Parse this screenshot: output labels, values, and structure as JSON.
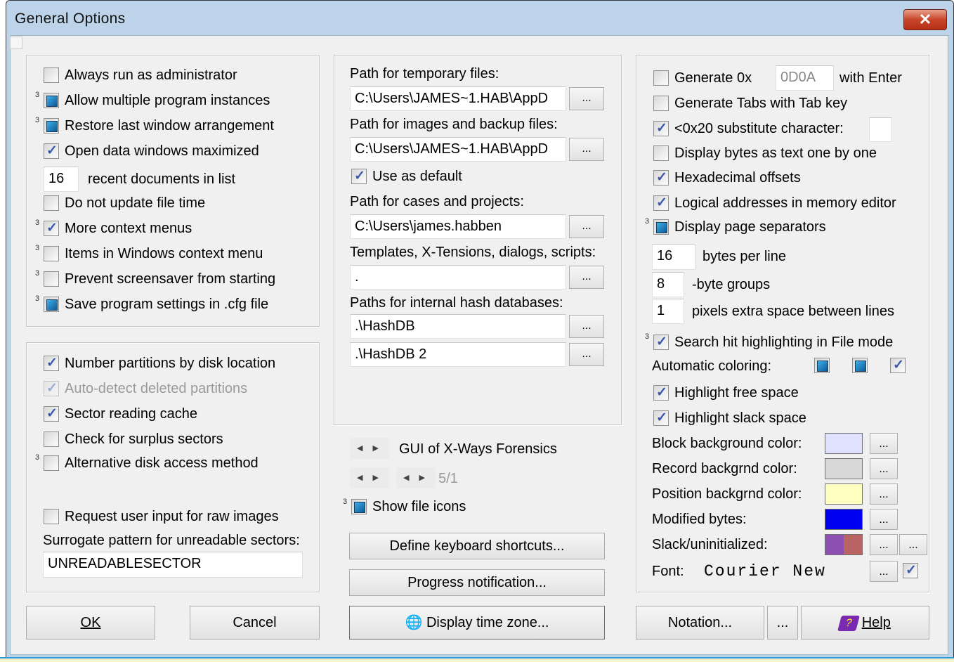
{
  "window": {
    "title": "General Options",
    "close": "✕"
  },
  "left": {
    "items": [
      {
        "label": "Always run as administrator",
        "state": "unchecked"
      },
      {
        "label": "Allow multiple program instances",
        "state": "indeterminate"
      },
      {
        "label": "Restore last window arrangement",
        "state": "indeterminate"
      },
      {
        "label": "Open data windows maximized",
        "state": "checked"
      },
      {
        "label": "Do not update file time",
        "state": "unchecked"
      },
      {
        "label": "More context menus",
        "state": "checked"
      },
      {
        "label": "Items in Windows context menu",
        "state": "unchecked"
      },
      {
        "label": "Prevent screensaver from starting",
        "state": "unchecked"
      },
      {
        "label": "Save program settings in .cfg file",
        "state": "indeterminate"
      }
    ],
    "recent_value": "16",
    "recent_label": "recent documents in list",
    "sup": "3"
  },
  "disk": {
    "items": [
      {
        "label": "Number partitions by disk location",
        "state": "checked"
      },
      {
        "label": "Auto-detect deleted partitions",
        "state": "checked-disabled"
      },
      {
        "label": "Sector reading cache",
        "state": "checked"
      },
      {
        "label": "Check for surplus sectors",
        "state": "unchecked"
      },
      {
        "label": "Alternative disk access method",
        "state": "unchecked"
      },
      {
        "label": "Request user input for raw images",
        "state": "unchecked"
      }
    ],
    "surrogate_label": "Surrogate pattern for unreadable sectors:",
    "surrogate_value": "UNREADABLESECTOR"
  },
  "paths": {
    "temp_label": "Path for temporary files:",
    "temp_value": "C:\\Users\\JAMES~1.HAB\\AppD",
    "images_label": "Path for images and backup files:",
    "images_value": "C:\\Users\\JAMES~1.HAB\\AppD",
    "use_default": "Use as default",
    "cases_label": "Path for cases and projects:",
    "cases_value": "C:\\Users\\james.habben",
    "templates_label": "Templates, X-Tensions, dialogs, scripts:",
    "templates_value": ".",
    "hash_label": "Paths for internal hash databases:",
    "hash1": ".\\HashDB",
    "hash2": ".\\HashDB 2",
    "browse": "..."
  },
  "gui": {
    "label": "GUI of X-Ways Forensics",
    "counter": "5/1",
    "show_icons": "Show file icons",
    "shortcuts": "Define keyboard shortcuts...",
    "progress": "Progress notification...",
    "timezone": "Display time zone..."
  },
  "right": {
    "gen0x_label": "Generate 0x",
    "gen0x_value": "0D0A",
    "gen0x_suffix": "with Enter",
    "tabs": "Generate Tabs with Tab key",
    "sub_label": "<0x20 substitute character:",
    "sub_value": "",
    "bytes_text": "Display bytes as text one by one",
    "hex_offsets": "Hexadecimal offsets",
    "logical": "Logical addresses in memory editor",
    "page_sep": "Display page separators",
    "bpl_value": "16",
    "bpl_label": "bytes per line",
    "groups_value": "8",
    "groups_label": "-byte groups",
    "pixels_value": "1",
    "pixels_label": "pixels extra space between lines",
    "search_hit": "Search hit highlighting in File mode",
    "auto_color": "Automatic coloring:",
    "free_space": "Highlight free space",
    "slack_space": "Highlight slack space",
    "block_color": "Block background color:",
    "record_color": "Record backgrnd color:",
    "position_color": "Position backgrnd color:",
    "modified": "Modified bytes:",
    "slack": "Slack/uninitialized:",
    "font_label": "Font:",
    "font_value": "Courier New",
    "colors": {
      "block": "#e0e0ff",
      "record": "#d8d8d8",
      "position": "#ffffc0",
      "modified": "#0000f0",
      "slack1": "#8c50b0",
      "slack2": "#b86464"
    }
  },
  "footer": {
    "ok": "OK",
    "cancel": "Cancel",
    "notation": "Notation...",
    "more": "...",
    "help": "Help"
  }
}
